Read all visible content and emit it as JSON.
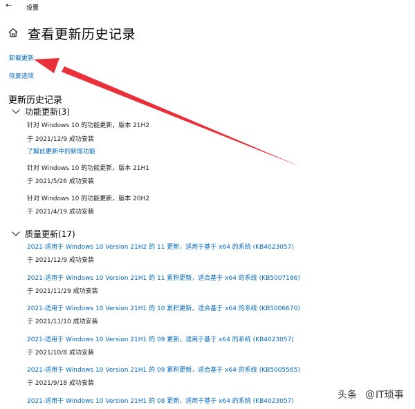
{
  "window": {
    "back_icon": "back-arrow-icon",
    "title": "设置"
  },
  "page": {
    "title": "查看更新历史记录",
    "home_icon": "home-icon"
  },
  "links": {
    "uninstall": "卸载更新",
    "recovery": "恢复选项"
  },
  "history": {
    "title": "更新历史记录",
    "feature_group": {
      "label": "功能更新(3)",
      "items": [
        {
          "title": "针对 Windows 10 的功能更新，版本 21H2",
          "status": "于 2021/12/9 成功安装",
          "extra_link": "了解此更新中的新增功能"
        },
        {
          "title": "针对 Windows 10 的功能更新，版本 21H1",
          "status": "于 2021/5/26 成功安装"
        },
        {
          "title": "针对 Windows 10 的功能更新，版本 20H2",
          "status": "于 2021/4/19 成功安装"
        }
      ]
    },
    "quality_group": {
      "label": "质量更新(17)",
      "items": [
        {
          "title": "2021-适用于 Windows 10 Version 21H2 的 11 更新，适用于基于 x64 的系统 (KB4023057)",
          "status": "于 2021/12/9 成功安装"
        },
        {
          "title": "2021-适用于 Windows 10 Version 21H1 的 11 累积更新，适合基于 x64 的系统 (KB5007186)",
          "status": "于 2021/11/29 成功安装"
        },
        {
          "title": "2021-适用于 Windows 10 Version 21H1 的 10 累积更新，适合基于 x64 的系统 (KB5006670)",
          "status": "于 2021/11/10 成功安装"
        },
        {
          "title": "2021-适用于 Windows 10 Version 21H1 的 09 更新，适用于基于 x64 的系统 (KB4023057)",
          "status": "于 2021/10/8 成功安装"
        },
        {
          "title": "2021-适用于 Windows 10 Version 21H1 的 09 累积更新，适合基于 x64 的系统 (KB5005565)",
          "status": "于 2021/9/18 成功安装"
        },
        {
          "title": "2021-适用于 Windows 10 Version 21H1 的 08 更新，适用于基于 x64 的系统 (KB4023057)"
        }
      ]
    }
  },
  "annotation": {
    "arrow_color": "#e8313a"
  },
  "watermark": {
    "source": "头条",
    "at": "@",
    "account": "IT琐事"
  },
  "colors": {
    "link": "#0067c0",
    "text": "#1a1a1a",
    "background": "#ffffff"
  }
}
